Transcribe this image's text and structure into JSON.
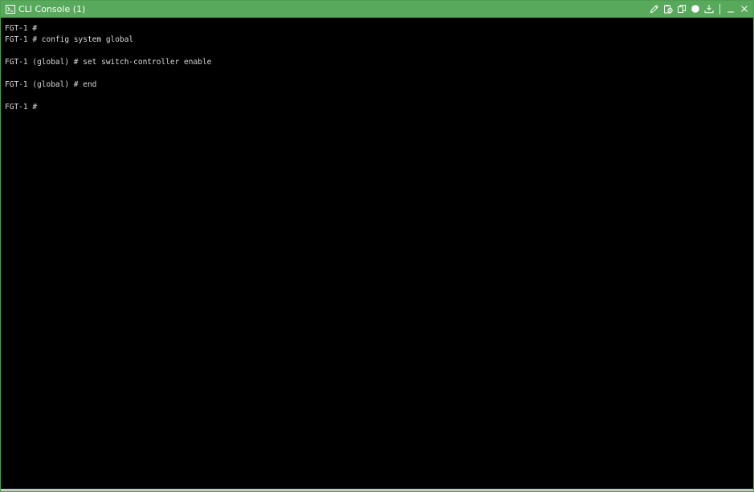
{
  "window": {
    "title": "CLI Console (1)",
    "accent_color": "#58a95c"
  },
  "toolbar": {
    "icons": [
      "terminal-icon",
      "pencil-icon",
      "paste-icon",
      "copy-icon",
      "circle-icon",
      "download-icon",
      "minimize-icon",
      "close-icon"
    ]
  },
  "terminal": {
    "lines": [
      "FGT-1 #",
      "FGT-1 # config system global",
      "",
      "FGT-1 (global) # set switch-controller enable",
      "",
      "FGT-1 (global) # end",
      "",
      "FGT-1 #"
    ]
  }
}
